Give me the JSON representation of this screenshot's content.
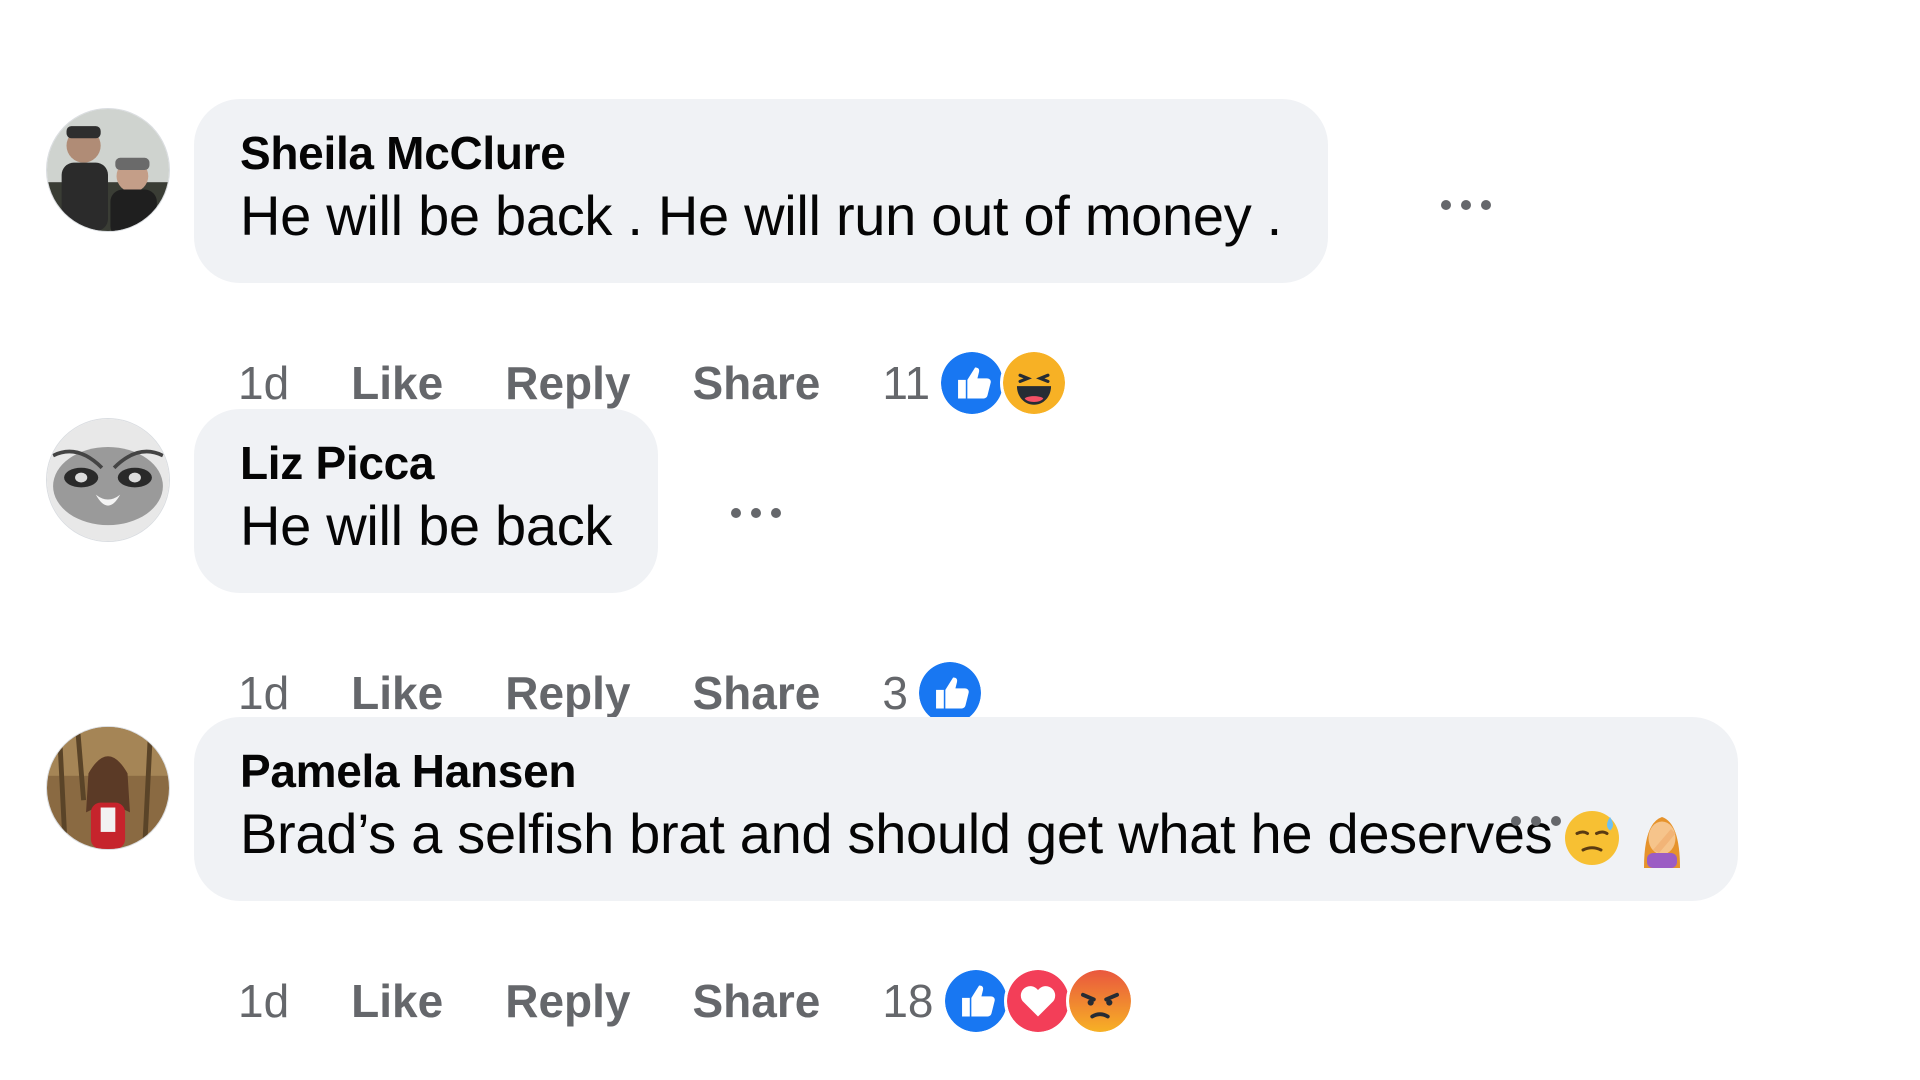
{
  "comments": [
    {
      "author": "Sheila McClure",
      "text": "He will be back . He will run out of money .",
      "text_emojis": [],
      "time": "1d",
      "like_label": "Like",
      "reply_label": "Reply",
      "share_label": "Share",
      "reaction_count": "11",
      "reaction_icons": [
        "like-icon",
        "haha-icon"
      ],
      "more_icon": "more-options-icon"
    },
    {
      "author": "Liz Picca",
      "text": "He will be back",
      "text_emojis": [],
      "time": "1d",
      "like_label": "Like",
      "reply_label": "Reply",
      "share_label": "Share",
      "reaction_count": "3",
      "reaction_icons": [
        "like-icon"
      ],
      "more_icon": "more-options-icon"
    },
    {
      "author": "Pamela Hansen",
      "text": "Brad’s a selfish brat and should get what he deserves",
      "text_emojis": [
        "sweat-smile-face-emoji",
        "facepalm-woman-emoji"
      ],
      "time": "1d",
      "like_label": "Like",
      "reply_label": "Reply",
      "share_label": "Share",
      "reaction_count": "18",
      "reaction_icons": [
        "like-icon",
        "love-icon",
        "angry-icon"
      ],
      "more_icon": "more-options-icon"
    }
  ],
  "colors": {
    "bubble_bg": "#f0f2f5",
    "secondary_text": "#65676b",
    "like_blue": "#1877f2",
    "love_red": "#f33e58"
  }
}
